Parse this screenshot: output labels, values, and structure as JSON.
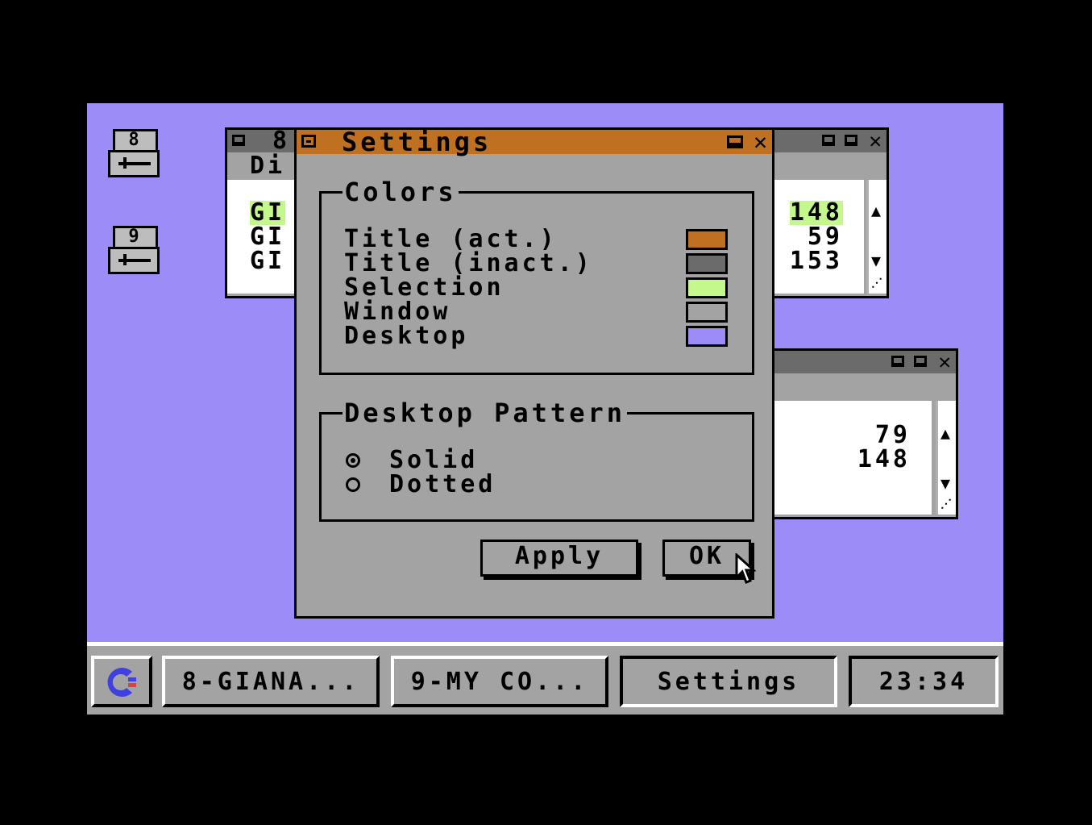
{
  "desktop": {
    "drives": [
      {
        "label": "8",
        "icon": "disk-drive-icon"
      },
      {
        "label": "9",
        "icon": "disk-drive-icon"
      }
    ]
  },
  "window_8": {
    "title_fragment": "8",
    "subtitle_fragment": "Di",
    "rows": [
      "GI",
      "GI",
      "GI"
    ],
    "sizes": [
      "148",
      "59",
      "153"
    ]
  },
  "window_9": {
    "sizes": [
      "79",
      "148"
    ]
  },
  "settings": {
    "title": "Settings",
    "colors_legend": "Colors",
    "color_rows": [
      {
        "label": "Title (act.)",
        "color": "#bf7020"
      },
      {
        "label": "Title (inact.)",
        "color": "#6b6b6b"
      },
      {
        "label": "Selection",
        "color": "#c4f88c"
      },
      {
        "label": "Window",
        "color": "#a3a3a3"
      },
      {
        "label": "Desktop",
        "color": "#9c8cf8"
      }
    ],
    "pattern_legend": "Desktop Pattern",
    "pattern_options": [
      {
        "label": "Solid",
        "selected": true
      },
      {
        "label": "Dotted",
        "selected": false
      }
    ],
    "apply_label": "Apply",
    "ok_label": "OK"
  },
  "taskbar": {
    "start_icon": "commodore-logo-icon",
    "tasks": [
      "8-GIANA...",
      "9-MY CO...",
      "Settings"
    ],
    "active_task": "Settings",
    "clock": "23:34"
  },
  "colors": {
    "desktop": "#9c8cf8",
    "active_title": "#bf7020",
    "inactive_title": "#6b6b6b",
    "selection": "#c4f88c",
    "window": "#a3a3a3"
  }
}
